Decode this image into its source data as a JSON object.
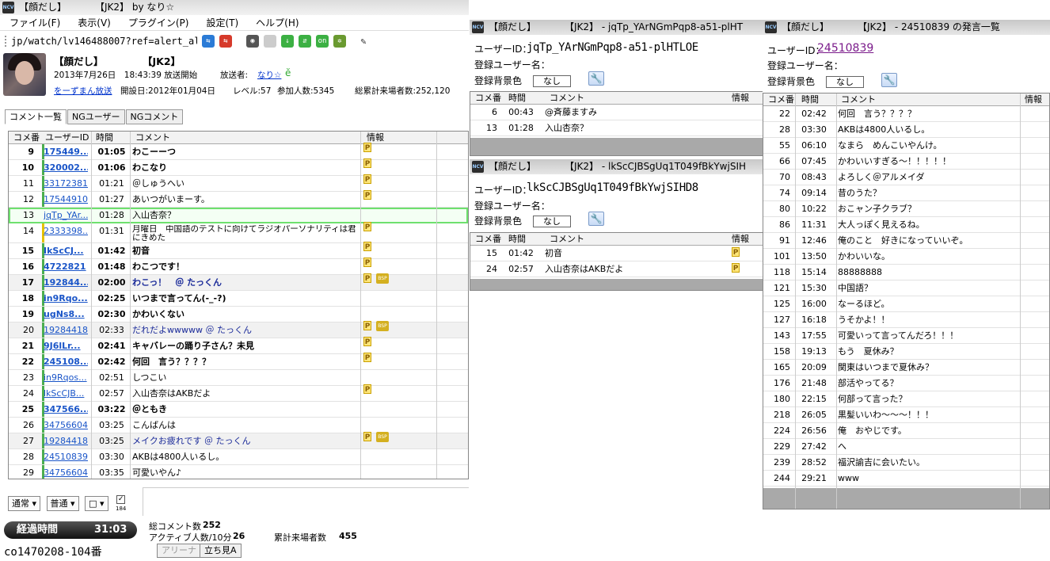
{
  "main": {
    "title": "【顔だし】　　　　【JK2】 by なり☆",
    "menu": [
      "ファイル(F)",
      "表示(V)",
      "プラグイン(P)",
      "設定(T)",
      "ヘルプ(H)"
    ],
    "url": "jp/watch/lv146488007?ref=alert_alert",
    "broadcast": {
      "title_left": "【顔だし】",
      "title_right": "【JK2】",
      "start": "2013年7月26日　18:43:39 放送開始",
      "broadcaster_label": "放送者:",
      "broadcaster": "なり☆",
      "community": "をーずまん放送",
      "opened": "開設日:2012年01月04日",
      "level": "レベル:57",
      "participants": "参加人数:5345",
      "total_visitors": "総累計来場者数:252,120"
    },
    "tabs": [
      "コメント一覧",
      "NGユーザー",
      "NGコメント"
    ],
    "columns": [
      "コメ番",
      "ユーザーID",
      "時間",
      "コメント",
      "情報"
    ],
    "rows": [
      {
        "no": "9",
        "uid": "175449...",
        "time": "01:05",
        "comment": "わこーーつ",
        "info": "P",
        "bold": true,
        "bar": "#4caf50"
      },
      {
        "no": "10",
        "uid": "320002...",
        "time": "01:06",
        "comment": "わこなり",
        "info": "P",
        "bold": true,
        "bar": "#4caf50"
      },
      {
        "no": "11",
        "uid": "33172381",
        "time": "01:21",
        "comment": "＠しゅうへい",
        "info": "P",
        "bar": "#4caf50"
      },
      {
        "no": "12",
        "uid": "17544910",
        "time": "01:27",
        "comment": "あいつがいまーす。",
        "info": "P",
        "bar": "#4caf50"
      },
      {
        "no": "13",
        "uid": "jqTp_YAr...",
        "time": "01:28",
        "comment": "入山杏奈？",
        "info": "",
        "sel": true
      },
      {
        "no": "14",
        "uid": "2333398...",
        "time": "01:31",
        "comment": "月曜日　中国語のテストに向けてラジオパーソナリティは君にきめた",
        "info": "P",
        "bar": "#e6c200",
        "two": true
      },
      {
        "no": "15",
        "uid": "IkScCJ...",
        "time": "01:42",
        "comment": "初音",
        "info": "P",
        "bold": true,
        "bar": "#4caf50"
      },
      {
        "no": "16",
        "uid": "4722821",
        "time": "01:48",
        "comment": "わこつです！",
        "info": "P",
        "bold": true,
        "bar": "#4caf50"
      },
      {
        "no": "17",
        "uid": "192844...",
        "time": "02:00",
        "comment": "わこっ！　＠ たっくん",
        "info": "P",
        "bsp": true,
        "bold": true,
        "blue": true,
        "gray": true,
        "bar": "#4caf50"
      },
      {
        "no": "18",
        "uid": "in9Rqo...",
        "time": "02:25",
        "comment": "いつまで言ってん(-_-?)",
        "info": "",
        "bold": true,
        "bar": "#4caf50"
      },
      {
        "no": "19",
        "uid": "ugNs8...",
        "time": "02:30",
        "comment": "かわいくない",
        "info": "",
        "bold": true,
        "bar": "#4caf50"
      },
      {
        "no": "20",
        "uid": "19284418",
        "time": "02:33",
        "comment": "だれだよwwwww ＠ たっくん",
        "info": "P",
        "bsp": true,
        "blue": true,
        "gray": true,
        "bar": "#4caf50"
      },
      {
        "no": "21",
        "uid": "9J6lLr...",
        "time": "02:41",
        "comment": "キャバレーの踊り子さん？未見",
        "info": "P",
        "bold": true,
        "bar": "#4caf50"
      },
      {
        "no": "22",
        "uid": "245108...",
        "time": "02:42",
        "comment": "何回　言う？？？？",
        "info": "P",
        "bold": true,
        "bar": "#4caf50"
      },
      {
        "no": "23",
        "uid": "in9Rqos...",
        "time": "02:51",
        "comment": "しつこい",
        "info": "",
        "bar": "#4caf50"
      },
      {
        "no": "24",
        "uid": "lkScCJB...",
        "time": "02:57",
        "comment": "入山杏奈はAKBだよ",
        "info": "P",
        "bar": "#4caf50"
      },
      {
        "no": "25",
        "uid": "347566...",
        "time": "03:22",
        "comment": "＠ともき",
        "info": "",
        "bold": true,
        "bar": "#4caf50"
      },
      {
        "no": "26",
        "uid": "34756604",
        "time": "03:25",
        "comment": "こんばんは",
        "info": "",
        "bar": "#4caf50"
      },
      {
        "no": "27",
        "uid": "19284418",
        "time": "03:25",
        "comment": "メイクお疲れです ＠ たっくん",
        "info": "P",
        "bsp": true,
        "blue": true,
        "gray": true,
        "bar": "#4caf50"
      },
      {
        "no": "28",
        "uid": "24510839",
        "time": "03:30",
        "comment": "AKBは4800人いるし。",
        "info": "",
        "bar": "#4caf50"
      },
      {
        "no": "29",
        "uid": "34756604",
        "time": "03:35",
        "comment": "可愛いやん♪",
        "info": "",
        "bar": "#4caf50"
      }
    ],
    "bottom": {
      "mode1": "通常",
      "mode2": "普通",
      "mode3": "□",
      "anon": "184",
      "elapsed_label": "経過時間",
      "elapsed": "31:03",
      "total_comments_label": "総コメント数",
      "total_comments": "252",
      "active_label": "アクティブ人数/10分",
      "active": "26",
      "cum_label": "累計来場者数",
      "cum": "455",
      "community_id": "co1470208-104番",
      "arena": "アリーナ",
      "standing": "立ち見A"
    }
  },
  "win2": {
    "title": "【顔だし】　　　　【JK2】 - jqTp_YArNGmPqp8-a51-plHT",
    "user_id_label": "ユーザーID：",
    "user_id": "jqTp_YArNGmPqp8-a51-plHTLOE",
    "reg_name_label": "登録ユーザー名：",
    "reg_bg_label": "登録背景色",
    "bg_value": "なし",
    "columns": [
      "コメ番",
      "時間",
      "コメント",
      "情報"
    ],
    "rows": [
      {
        "no": "6",
        "time": "00:43",
        "comment": "@斉藤ますみ",
        "info": ""
      },
      {
        "no": "13",
        "time": "01:28",
        "comment": "入山杏奈？",
        "info": ""
      }
    ]
  },
  "win3": {
    "title": "【顔だし】　　　　【JK2】 - lkScCJBSgUq1T049fBkYwjSIH",
    "user_id_label": "ユーザーID：",
    "user_id": "lkScCJBSgUq1T049fBkYwjSIHD8",
    "reg_name_label": "登録ユーザー名：",
    "reg_bg_label": "登録背景色",
    "bg_value": "なし",
    "columns": [
      "コメ番",
      "時間",
      "コメント",
      "情報"
    ],
    "rows": [
      {
        "no": "15",
        "time": "01:42",
        "comment": "初音",
        "info": "P"
      },
      {
        "no": "24",
        "time": "02:57",
        "comment": "入山杏奈はAKBだよ",
        "info": "P"
      }
    ]
  },
  "win4": {
    "title": "【顔だし】　　　　【JK2】 - 24510839 の発言一覧",
    "user_id_label": "ユーザーID：",
    "user_id": "24510839",
    "reg_name_label": "登録ユーザー名：",
    "reg_bg_label": "登録背景色",
    "bg_value": "なし",
    "columns": [
      "コメ番",
      "時間",
      "コメント",
      "情報"
    ],
    "rows": [
      {
        "no": "22",
        "time": "02:42",
        "comment": "何回　言う？？？？"
      },
      {
        "no": "28",
        "time": "03:30",
        "comment": "AKBは4800人いるし。"
      },
      {
        "no": "55",
        "time": "06:10",
        "comment": "なまら　めんこいやんけ。"
      },
      {
        "no": "66",
        "time": "07:45",
        "comment": "かわいいすぎる～！！！！！"
      },
      {
        "no": "70",
        "time": "08:43",
        "comment": "よろしく＠アルメイダ"
      },
      {
        "no": "74",
        "time": "09:14",
        "comment": "昔のうた？"
      },
      {
        "no": "80",
        "time": "10:22",
        "comment": "おこャン子クラブ？"
      },
      {
        "no": "86",
        "time": "11:31",
        "comment": "大人っぽく見えるね。"
      },
      {
        "no": "91",
        "time": "12:46",
        "comment": "俺のこと　好きになっていいぞ。"
      },
      {
        "no": "101",
        "time": "13:50",
        "comment": "かわいいな。"
      },
      {
        "no": "118",
        "time": "15:14",
        "comment": "88888888"
      },
      {
        "no": "121",
        "time": "15:30",
        "comment": "中国語？"
      },
      {
        "no": "125",
        "time": "16:00",
        "comment": "なーるほど。"
      },
      {
        "no": "127",
        "time": "16:18",
        "comment": "うそかよ！！"
      },
      {
        "no": "143",
        "time": "17:55",
        "comment": "可愛いって言ってんだろ！！！"
      },
      {
        "no": "158",
        "time": "19:13",
        "comment": "もう　夏休み？"
      },
      {
        "no": "165",
        "time": "20:09",
        "comment": "関東はいつまで夏休み？"
      },
      {
        "no": "176",
        "time": "21:48",
        "comment": "部活やってる？"
      },
      {
        "no": "180",
        "time": "22:15",
        "comment": "何部って言った？"
      },
      {
        "no": "218",
        "time": "26:05",
        "comment": "黒髪いいわ～～～！！！"
      },
      {
        "no": "224",
        "time": "26:56",
        "comment": "俺　おやじです。"
      },
      {
        "no": "229",
        "time": "27:42",
        "comment": "へ"
      },
      {
        "no": "239",
        "time": "28:52",
        "comment": "福沢諭吉に会いたい。"
      },
      {
        "no": "244",
        "time": "29:21",
        "comment": "www"
      }
    ]
  },
  "colors": {
    "link": "#0033cc",
    "selected_outline": "#6ee06e",
    "id_link_purple": "#7a1a8a"
  }
}
